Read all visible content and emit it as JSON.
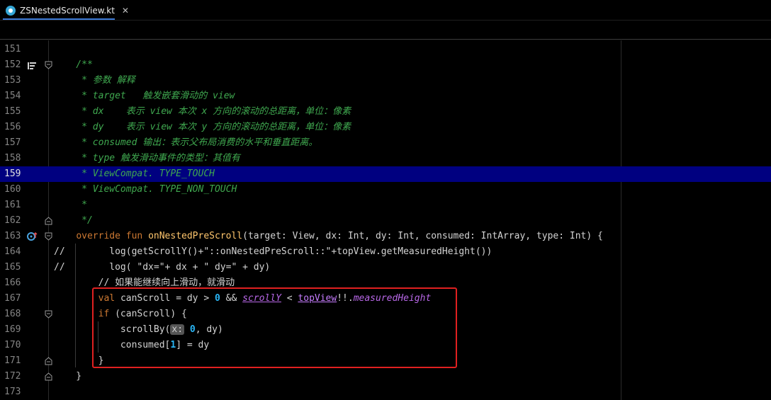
{
  "tab": {
    "title": "ZSNestedScrollView.kt",
    "close": "✕"
  },
  "lines": [
    {
      "n": "151",
      "segs": []
    },
    {
      "n": "152",
      "segs": [
        {
          "t": "    /**",
          "c": "c-comment"
        }
      ]
    },
    {
      "n": "153",
      "segs": [
        {
          "t": "     * 参数 解释",
          "c": "c-comment"
        }
      ]
    },
    {
      "n": "154",
      "segs": [
        {
          "t": "     * target   触发嵌套滑动的 view",
          "c": "c-comment"
        }
      ]
    },
    {
      "n": "155",
      "segs": [
        {
          "t": "     * dx    表示 view 本次 x 方向的滚动的总距离，单位：像素",
          "c": "c-comment"
        }
      ]
    },
    {
      "n": "156",
      "segs": [
        {
          "t": "     * dy    表示 view 本次 y 方向的滚动的总距离，单位：像素",
          "c": "c-comment"
        }
      ]
    },
    {
      "n": "157",
      "segs": [
        {
          "t": "     * consumed 输出：表示父布局消费的水平和垂直距离。",
          "c": "c-comment"
        }
      ]
    },
    {
      "n": "158",
      "segs": [
        {
          "t": "     * type 触发滑动事件的类型：其值有",
          "c": "c-comment"
        }
      ]
    },
    {
      "n": "159",
      "segs": [
        {
          "t": "     * ViewCompat. TYPE_TOUCH",
          "c": "c-comment"
        }
      ]
    },
    {
      "n": "160",
      "segs": [
        {
          "t": "     * ViewCompat. TYPE_NON_TOUCH",
          "c": "c-comment"
        }
      ]
    },
    {
      "n": "161",
      "segs": [
        {
          "t": "     *",
          "c": "c-comment"
        }
      ]
    },
    {
      "n": "162",
      "segs": [
        {
          "t": "     */",
          "c": "c-comment"
        }
      ]
    },
    {
      "n": "163",
      "segs": [
        {
          "t": "    "
        },
        {
          "t": "override fun ",
          "c": "c-keyword"
        },
        {
          "t": "onNestedPreScroll",
          "c": "c-func"
        },
        {
          "t": "(target: View, dx: Int, dy: Int, consumed: IntArray, type: Int) {"
        }
      ]
    },
    {
      "n": "164",
      "segs": [
        {
          "t": "//        log(getScrollY()+\"::onNestedPreScroll::\"+topView.getMeasuredHeight())"
        }
      ]
    },
    {
      "n": "165",
      "segs": [
        {
          "t": "//        log( \"dx=\"+ dx + \" dy=\" + dy)"
        }
      ]
    },
    {
      "n": "166",
      "segs": [
        {
          "t": "        "
        },
        {
          "t": "// 如果能继续向上滑动，就滑动",
          "c": "c-chinese"
        }
      ]
    },
    {
      "n": "167",
      "segs": [
        {
          "t": "        "
        },
        {
          "t": "val ",
          "c": "c-keyword"
        },
        {
          "t": "canScroll = dy > "
        },
        {
          "t": "0",
          "c": "c-num"
        },
        {
          "t": " && "
        },
        {
          "t": "scrollY",
          "c": "c-ulprop"
        },
        {
          "t": " < "
        },
        {
          "t": "topView",
          "c": "c-ulfield"
        },
        {
          "t": "!!."
        },
        {
          "t": "measuredHeight",
          "c": "c-prop"
        }
      ]
    },
    {
      "n": "168",
      "segs": [
        {
          "t": "        "
        },
        {
          "t": "if",
          "c": "c-keyword"
        },
        {
          "t": " (canScroll) {"
        }
      ]
    },
    {
      "n": "169",
      "segs": [
        {
          "t": "            scrollBy("
        },
        {
          "t": "x:",
          "c": "hint"
        },
        {
          "t": " "
        },
        {
          "t": "0",
          "c": "c-num"
        },
        {
          "t": ", dy)"
        }
      ]
    },
    {
      "n": "170",
      "segs": [
        {
          "t": "            consumed["
        },
        {
          "t": "1",
          "c": "c-num"
        },
        {
          "t": "] = dy"
        }
      ]
    },
    {
      "n": "171",
      "segs": [
        {
          "t": "        }"
        }
      ]
    },
    {
      "n": "172",
      "segs": [
        {
          "t": "    }"
        }
      ]
    },
    {
      "n": "173",
      "segs": []
    }
  ]
}
